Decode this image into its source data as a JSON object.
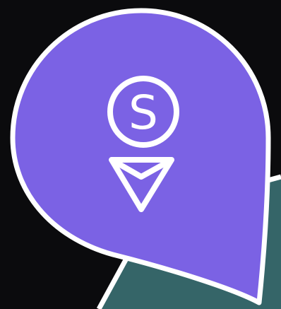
{
  "badge": {
    "letter": "S",
    "icon": "arrow-down-icon"
  },
  "colors": {
    "background": "#0b0b0d",
    "badge_fill": "#7b62e4",
    "outline": "#ffffff",
    "panel": "#356568"
  }
}
